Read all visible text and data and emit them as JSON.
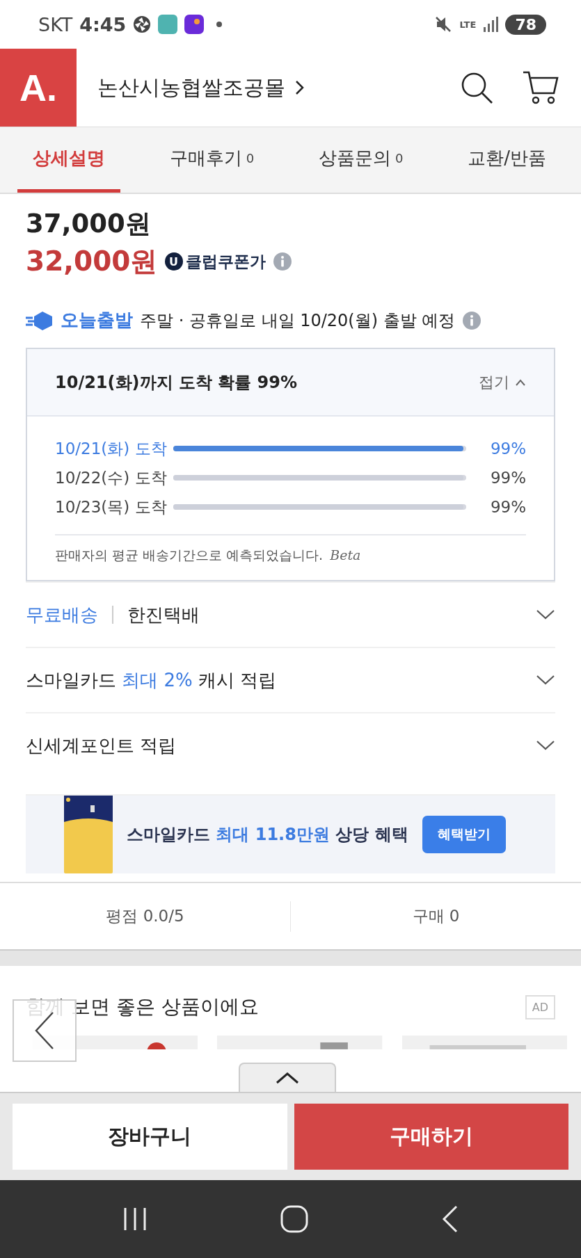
{
  "status_bar": {
    "carrier": "SKT",
    "time": "4:45",
    "network": "LTE",
    "battery": "78"
  },
  "header": {
    "logo": "A.",
    "store_name": "논산시농협쌀조공몰"
  },
  "tabs": [
    {
      "label": "상세설명",
      "selected": true
    },
    {
      "label": "구매후기",
      "count": "0",
      "selected": false
    },
    {
      "label": "상품문의",
      "count": "0",
      "selected": false
    },
    {
      "label": "교환/반품",
      "selected": false
    }
  ],
  "price": {
    "original": "37,000원",
    "sale": "32,000원",
    "coupon_badge": "U",
    "coupon_label": "클럽쿠폰가"
  },
  "dispatch": {
    "badge": "오늘출발",
    "text": "주말 · 공휴일로 내일 10/20(월) 출발 예정"
  },
  "arrival": {
    "title": "10/21(화)까지 도착 확률 99%",
    "toggle": "접기",
    "expanded": true,
    "rows": [
      {
        "label": "10/21(화) 도착",
        "level": 0.99,
        "reading": "99%",
        "highlighted": true
      },
      {
        "label": "10/22(수) 도착",
        "level": 0.99,
        "reading": "99%",
        "highlighted": false
      },
      {
        "label": "10/23(목) 도착",
        "level": 0.99,
        "reading": "99%",
        "highlighted": false
      }
    ],
    "note": "판매자의 평균 배송기간으로 예측되었습니다.",
    "note_tag": "Beta"
  },
  "benefits": [
    {
      "kind": "shipping",
      "parts": [
        {
          "text": "무료배송",
          "accent": true
        },
        {
          "text": "한진택배",
          "accent": false
        }
      ]
    },
    {
      "kind": "text",
      "parts": [
        {
          "text": "스마일카드 ",
          "accent": false
        },
        {
          "text": "최대 2%",
          "accent": true
        },
        {
          "text": " 캐시 적립",
          "accent": false
        }
      ]
    },
    {
      "kind": "text",
      "parts": [
        {
          "text": "신세계포인트 적립",
          "accent": false
        }
      ]
    }
  ],
  "banner": {
    "parts": [
      {
        "text": "스마일카드 ",
        "accent": false
      },
      {
        "text": "최대 11.8만원",
        "accent": true
      },
      {
        "text": " 상당 혜택",
        "accent": false
      }
    ],
    "button": "혜택받기"
  },
  "stats": [
    "평점 0.0/5",
    "구매 0"
  ],
  "recommend": {
    "title": "함께 보면 좋은 상품이에요",
    "ad": "AD"
  },
  "actions": {
    "cart": "장바구니",
    "buy": "구매하기"
  }
}
